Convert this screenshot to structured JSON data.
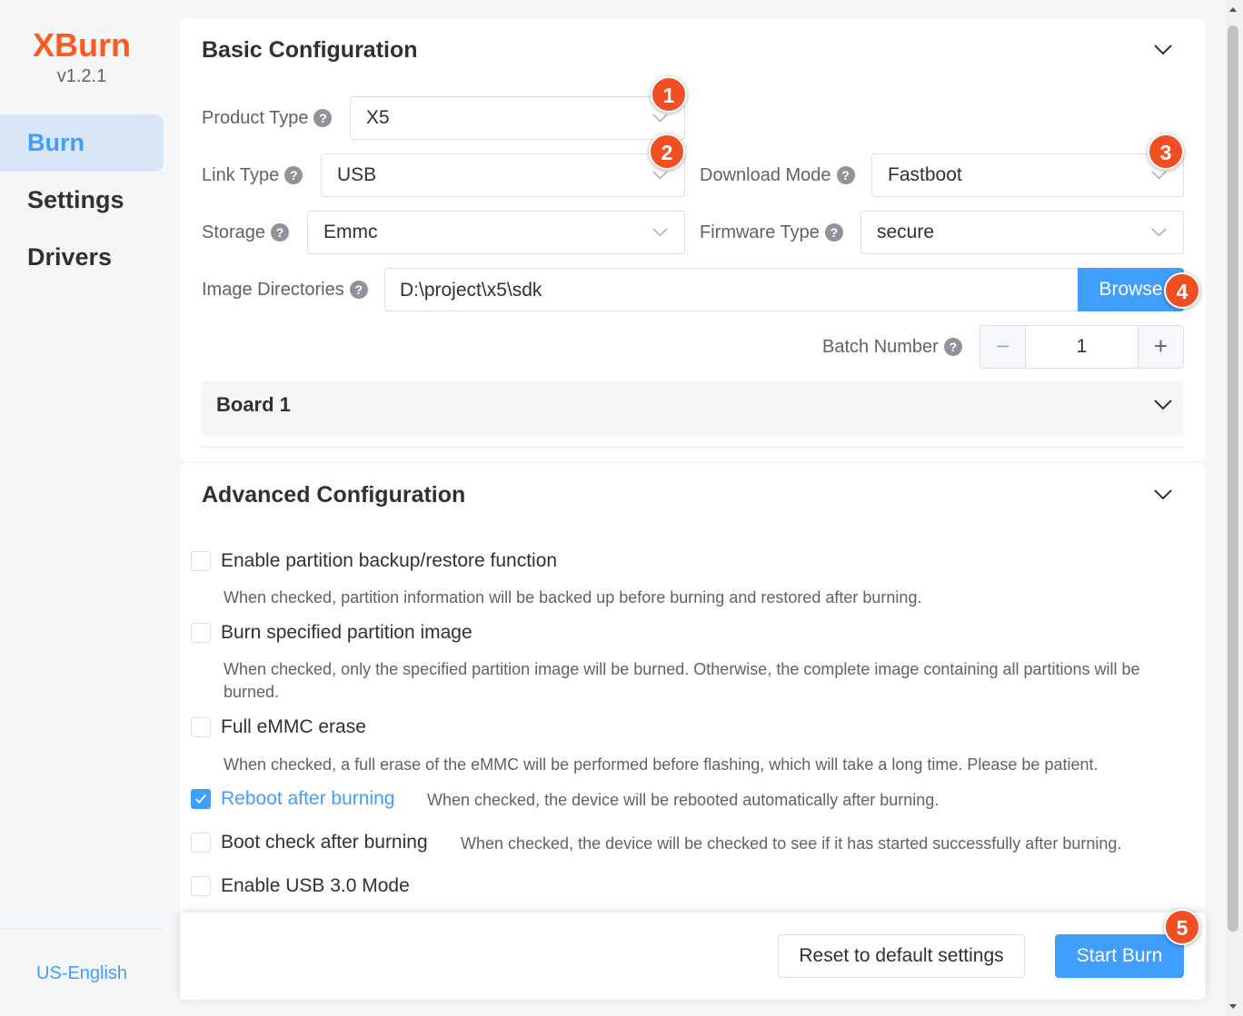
{
  "app": {
    "name": "XBurn",
    "version": "v1.2.1"
  },
  "nav": {
    "burn": "Burn",
    "settings": "Settings",
    "drivers": "Drivers",
    "language": "US-English"
  },
  "basic": {
    "title": "Basic Configuration",
    "product_type": {
      "label": "Product Type",
      "value": "X5"
    },
    "link_type": {
      "label": "Link Type",
      "value": "USB"
    },
    "download_mode": {
      "label": "Download Mode",
      "value": "Fastboot"
    },
    "storage": {
      "label": "Storage",
      "value": "Emmc"
    },
    "firmware_type": {
      "label": "Firmware Type",
      "value": "secure"
    },
    "image_dirs": {
      "label": "Image Directories",
      "value": "D:\\project\\x5\\sdk",
      "button": "Browse"
    },
    "batch": {
      "label": "Batch Number",
      "value": "1",
      "minus": "−",
      "plus": "+"
    },
    "board": {
      "title": "Board 1"
    },
    "help_glyph": "?"
  },
  "advanced": {
    "title": "Advanced Configuration",
    "options": [
      {
        "label": "Enable partition backup/restore function",
        "desc": "When checked, partition information will be backed up before burning and restored after burning.",
        "checked": false
      },
      {
        "label": "Burn specified partition image",
        "desc": "When checked, only the specified partition image will be burned. Otherwise, the complete image containing all partitions will be burned.",
        "checked": false
      },
      {
        "label": "Full eMMC erase",
        "desc": "When checked, a full erase of the eMMC will be performed before flashing, which will take a long time. Please be patient.",
        "checked": false
      },
      {
        "label": "Reboot after burning",
        "desc": "When checked, the device will be rebooted automatically after burning.",
        "checked": true
      },
      {
        "label": "Boot check after burning",
        "desc": "When checked, the device will be checked to see if it has started successfully after burning.",
        "checked": false
      },
      {
        "label": "Enable USB 3.0 Mode",
        "checked": false
      }
    ]
  },
  "footer": {
    "reset": "Reset to default settings",
    "start": "Start Burn"
  },
  "badges": [
    "1",
    "2",
    "3",
    "4",
    "5"
  ],
  "colors": {
    "accent": "#409eff",
    "brand": "#ff5a1f",
    "badge": "#f04e23"
  }
}
